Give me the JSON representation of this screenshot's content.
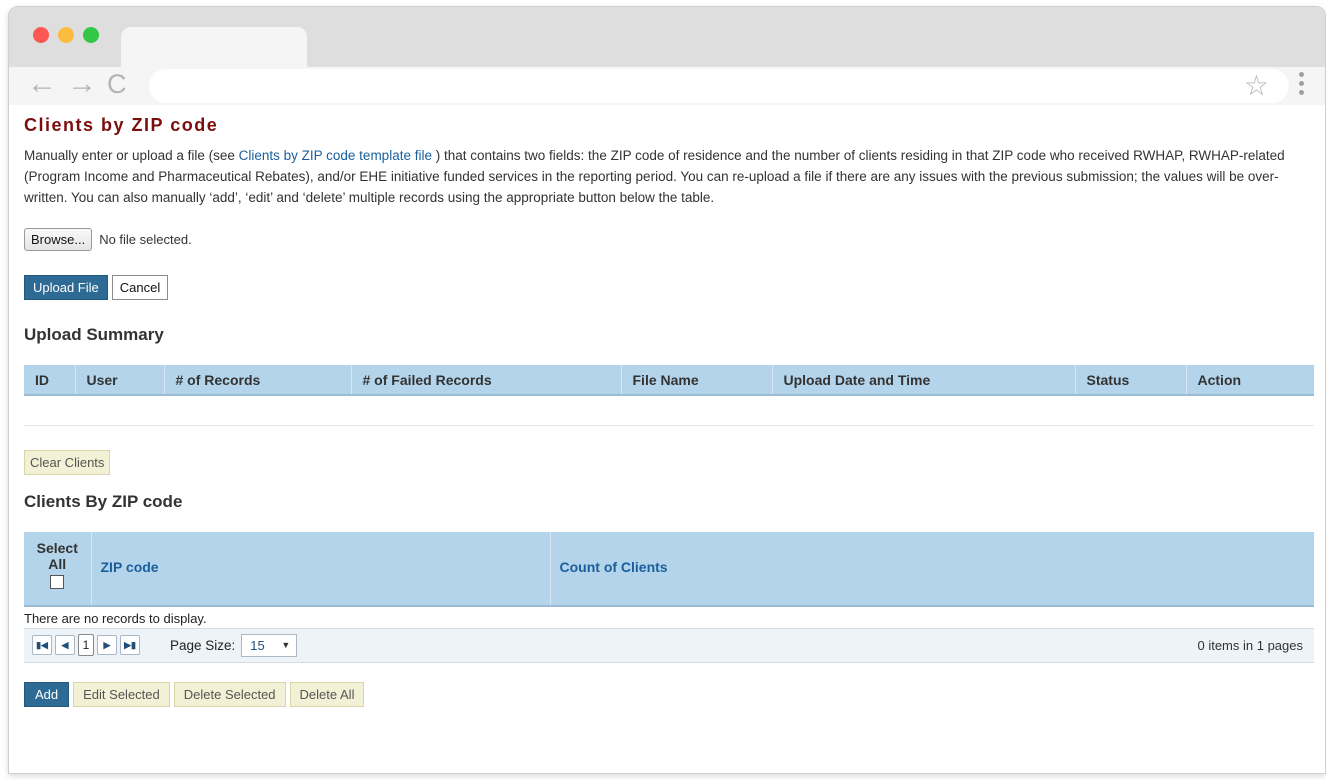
{
  "browser": {
    "back_icon": "←",
    "forward_icon": "→",
    "reload_icon": "C",
    "star_icon": "☆"
  },
  "page": {
    "title": "Clients by ZIP code",
    "intro_before_link": "Manually enter or upload a file (see ",
    "intro_link": "Clients by ZIP code template file",
    "intro_after_link": " ) that contains two fields: the ZIP code of residence and the number of clients residing in that ZIP code who received RWHAP, RWHAP-related (Program Income and Pharmaceutical Rebates), and/or EHE initiative funded services in the reporting period. You can re-upload a file if there are any issues with the previous submission; the values will be over-written. You can also manually ‘add’, ‘edit’ and ‘delete’ multiple records using the appropriate button below the table."
  },
  "file_input": {
    "browse_label": "Browse...",
    "status": "No file selected."
  },
  "upload_buttons": {
    "upload_label": "Upload File",
    "cancel_label": "Cancel"
  },
  "upload_summary": {
    "title": "Upload Summary",
    "columns": [
      "ID",
      "User",
      "# of Records",
      "# of Failed Records",
      "File Name",
      "Upload Date and Time",
      "Status",
      "Action"
    ]
  },
  "clear_clients_label": "Clear Clients",
  "clients": {
    "title": "Clients By ZIP code",
    "select_all_line1": "Select",
    "select_all_line2": "All",
    "zip_header": "ZIP code",
    "count_header": "Count of Clients",
    "empty_message": "There are no records to display."
  },
  "pager": {
    "current_page": "1",
    "page_size_label": "Page Size:",
    "page_size_value": "15",
    "info": "0 items in 1 pages"
  },
  "actions": {
    "add": "Add",
    "edit": "Edit Selected",
    "delete": "Delete Selected",
    "delete_all": "Delete All"
  },
  "colors": {
    "title": "#7b0d0d",
    "link": "#1a5f9c",
    "primary_button": "#2e6b94",
    "table_header": "#b3d4ea",
    "secondary_button": "#f2f1d5"
  }
}
